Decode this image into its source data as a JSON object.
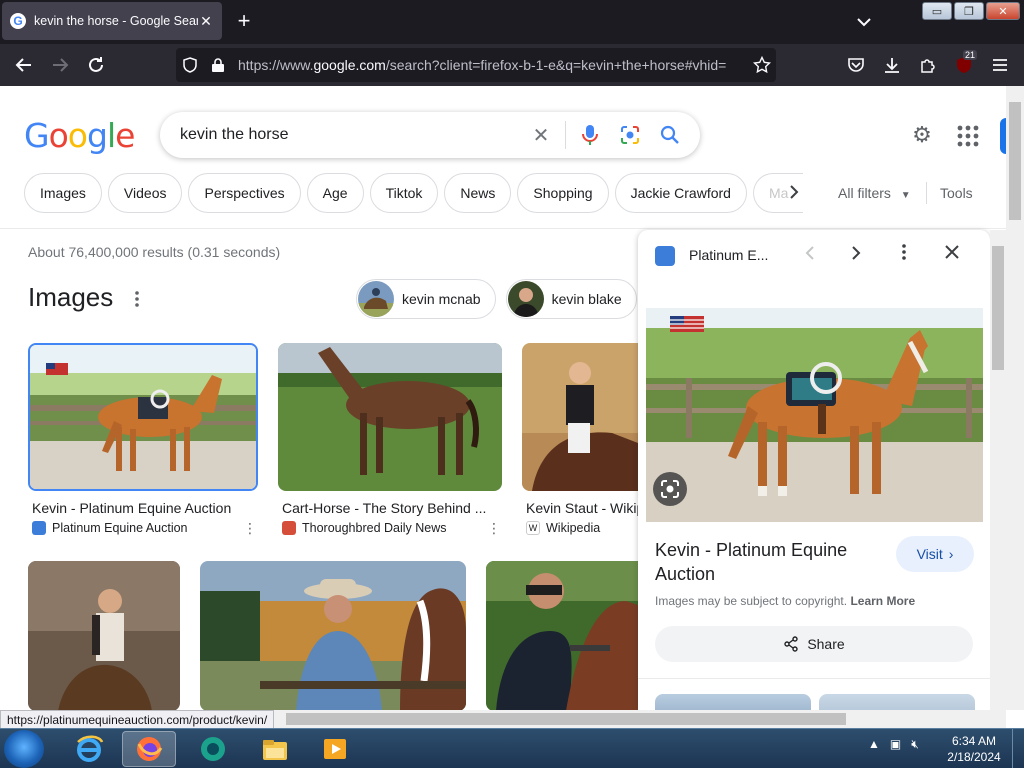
{
  "browser": {
    "tab_title": "kevin the horse - Google Search",
    "tab_close": "✕",
    "new_tab": "+",
    "url_host_prefix": "https://www.",
    "url_host": "google.com",
    "url_rest": "/search?client=firefox-b-1-e&q=kevin+the+horse#vhid=",
    "extension_badge": "21",
    "window_buttons": {
      "minimize": "▭",
      "restore": "❐",
      "close": "✕"
    }
  },
  "google": {
    "logo": [
      "G",
      "o",
      "o",
      "g",
      "l",
      "e"
    ],
    "logo_colors": [
      "#4285f4",
      "#ea4335",
      "#fbbc05",
      "#4285f4",
      "#34a853",
      "#ea4335"
    ],
    "query": "kevin the horse",
    "clear_icon": "✕"
  },
  "chips": [
    "Images",
    "Videos",
    "Perspectives",
    "Age",
    "Tiktok",
    "News",
    "Shopping",
    "Jackie Crawford",
    "Ma"
  ],
  "filters": {
    "all_filters": "All filters",
    "tools": "Tools"
  },
  "results": {
    "stats": "About 76,400,000 results (0.31 seconds)",
    "images_heading": "Images",
    "related_people": [
      "kevin mcnab",
      "kevin blake"
    ]
  },
  "image_cards": [
    {
      "title": "Kevin - Platinum Equine Auction",
      "source": "Platinum Equine Auction"
    },
    {
      "title": "Cart-Horse - The Story Behind ...",
      "source": "Thoroughbred Daily News"
    },
    {
      "title": "Kevin Staut - Wikip",
      "source": "Wikipedia"
    }
  ],
  "side_panel": {
    "site": "Platinum E...",
    "title": "Kevin - Platinum Equine Auction",
    "visit": "Visit",
    "copyright": "Images may be subject to copyright.",
    "learn_more": "Learn More",
    "share": "Share"
  },
  "status_bar_url": "https://platinumequineauction.com/product/kevin/",
  "taskbar": {
    "time": "6:34 AM",
    "date": "2/18/2024"
  },
  "colors": {
    "google_blue": "#1a73e8",
    "firefox_tab_dark": "#1c1b22",
    "firefox_toolbar": "#2b2a33"
  }
}
